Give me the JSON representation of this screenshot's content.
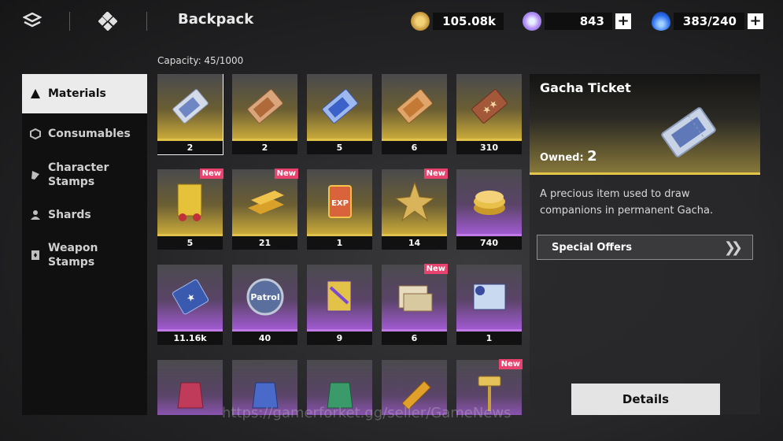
{
  "header": {
    "title": "Backpack",
    "icons": [
      "menu-icon",
      "inventory-icon"
    ],
    "currencies": [
      {
        "name": "gold-coin",
        "value": "105.08k",
        "color": "#d8b24a",
        "has_plus": false
      },
      {
        "name": "premium-gem",
        "value": "843",
        "color": "#c8a6ff",
        "has_plus": true
      },
      {
        "name": "stamina-flame",
        "value": "383/240",
        "color": "#2b6ff0",
        "has_plus": true
      }
    ]
  },
  "capacity": "Capacity: 45/1000",
  "sidebar": {
    "items": [
      {
        "label": "Materials",
        "icon": "materials-icon",
        "active": true
      },
      {
        "label": "Consumables",
        "icon": "consumables-icon",
        "active": false
      },
      {
        "label": "Character\nStamps",
        "icon": "character-stamp-icon",
        "active": false
      },
      {
        "label": "Shards",
        "icon": "shards-icon",
        "active": false
      },
      {
        "label": "Weapon\nStamps",
        "icon": "weapon-stamp-icon",
        "active": false
      }
    ]
  },
  "grid": {
    "new_label": "New",
    "items": [
      {
        "name": "gacha-ticket",
        "qty": "2",
        "rarity": "gold",
        "new": false,
        "selected": true,
        "icon": "silver-ticket-icon"
      },
      {
        "name": "bronze-ticket",
        "qty": "2",
        "rarity": "gold",
        "new": false,
        "icon": "bronze-ticket-icon"
      },
      {
        "name": "blue-ticket",
        "qty": "5",
        "rarity": "gold",
        "new": false,
        "icon": "blue-ticket-icon"
      },
      {
        "name": "copper-ticket",
        "qty": "6",
        "rarity": "gold",
        "new": false,
        "icon": "copper-ticket-icon"
      },
      {
        "name": "star-ticket",
        "qty": "310",
        "rarity": "gold",
        "new": false,
        "icon": "star-ticket-icon"
      },
      {
        "name": "gold-charm",
        "qty": "5",
        "rarity": "gold",
        "new": true,
        "icon": "gold-charm-icon"
      },
      {
        "name": "gold-bars",
        "qty": "21",
        "rarity": "gold",
        "new": true,
        "icon": "gold-bars-icon"
      },
      {
        "name": "exp-card",
        "qty": "1",
        "rarity": "gold",
        "new": false,
        "icon": "exp-card-icon"
      },
      {
        "name": "gold-star",
        "qty": "14",
        "rarity": "gold",
        "new": true,
        "icon": "gold-star-icon"
      },
      {
        "name": "coin-stack",
        "qty": "740",
        "rarity": "purple",
        "new": false,
        "icon": "coin-stack-icon"
      },
      {
        "name": "blue-star-ticket",
        "qty": "11.16k",
        "rarity": "purple",
        "new": false,
        "icon": "blue-star-ticket-icon"
      },
      {
        "name": "patrol-badge",
        "qty": "40",
        "rarity": "purple",
        "new": false,
        "icon": "patrol-badge-icon"
      },
      {
        "name": "purple-charm",
        "qty": "9",
        "rarity": "purple",
        "new": false,
        "icon": "purple-charm-icon"
      },
      {
        "name": "scroll-bundle",
        "qty": "6",
        "rarity": "purple",
        "new": true,
        "icon": "scroll-bundle-icon"
      },
      {
        "name": "blue-scroll",
        "qty": "1",
        "rarity": "purple",
        "new": false,
        "icon": "blue-scroll-icon"
      },
      {
        "name": "red-pouch",
        "qty": "",
        "rarity": "purple",
        "new": false,
        "icon": "red-pouch-icon"
      },
      {
        "name": "blue-pouch",
        "qty": "",
        "rarity": "purple",
        "new": false,
        "icon": "blue-pouch-icon"
      },
      {
        "name": "green-pouch",
        "qty": "",
        "rarity": "purple",
        "new": false,
        "icon": "green-pouch-icon"
      },
      {
        "name": "gold-ingot",
        "qty": "",
        "rarity": "purple",
        "new": false,
        "icon": "gold-ingot-icon"
      },
      {
        "name": "gold-hammer",
        "qty": "",
        "rarity": "purple",
        "new": true,
        "icon": "gold-hammer-icon"
      }
    ]
  },
  "detail": {
    "title": "Gacha Ticket",
    "owned_label": "Owned:",
    "owned_value": "2",
    "description": "A precious item used to draw companions in permanent Gacha.",
    "offers_label": "Special Offers",
    "details_button": "Details"
  },
  "watermark": "https://gamerforket.gg/seller/GameNews"
}
